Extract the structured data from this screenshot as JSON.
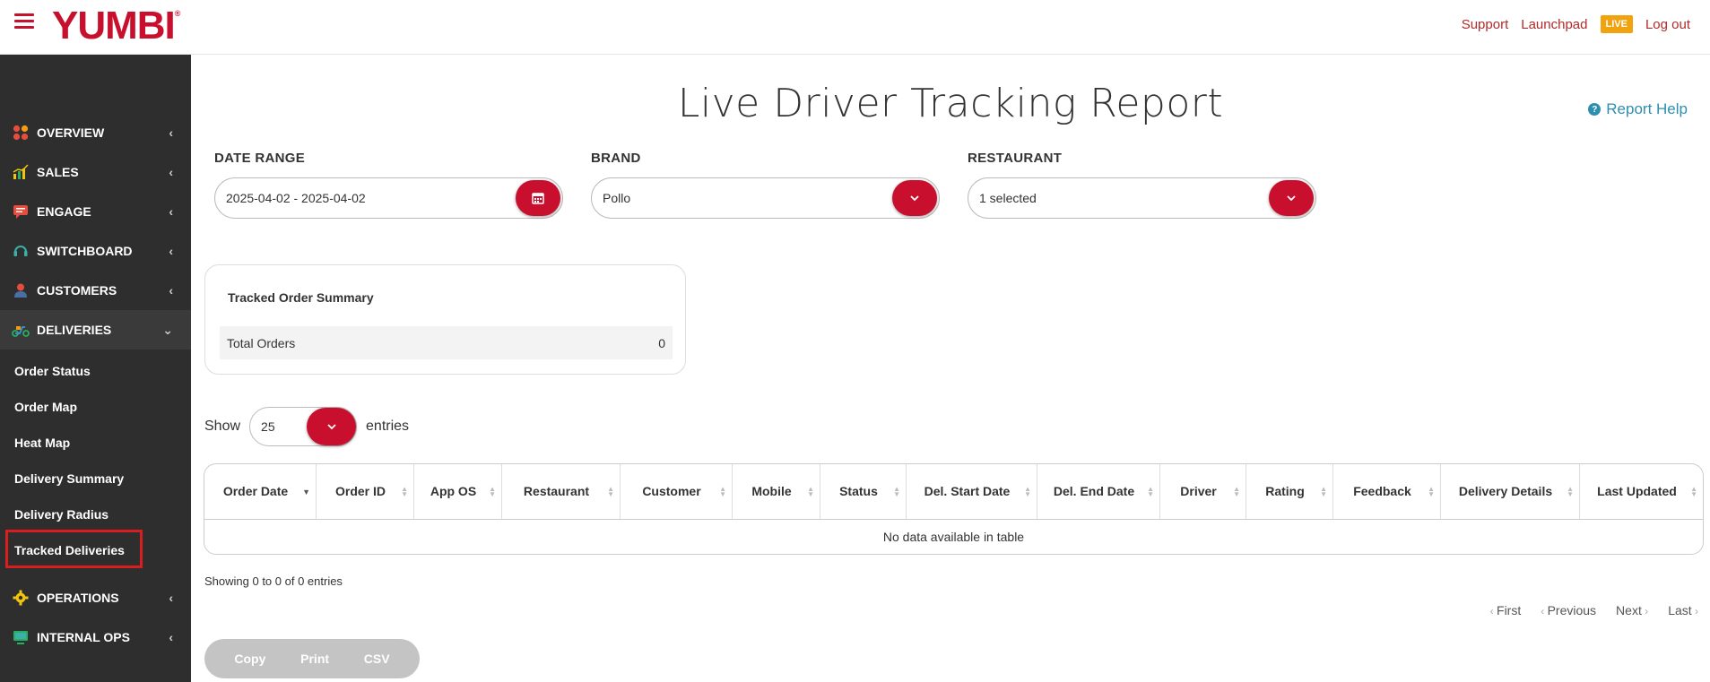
{
  "brand": {
    "logo": "YUMBI",
    "reg": "®",
    "color": "#c8102e"
  },
  "topnav": {
    "support": "Support",
    "launchpad": "Launchpad",
    "live": "LIVE",
    "logout": "Log out"
  },
  "sidebar": {
    "items": [
      {
        "label": "OVERVIEW",
        "icon": "dots-grid-icon"
      },
      {
        "label": "SALES",
        "icon": "bar-chart-icon"
      },
      {
        "label": "ENGAGE",
        "icon": "chat-icon"
      },
      {
        "label": "SWITCHBOARD",
        "icon": "headset-icon"
      },
      {
        "label": "CUSTOMERS",
        "icon": "user-icon"
      },
      {
        "label": "DELIVERIES",
        "icon": "scooter-icon"
      },
      {
        "label": "OPERATIONS",
        "icon": "gear-icon"
      },
      {
        "label": "INTERNAL OPS",
        "icon": "monitor-icon"
      }
    ],
    "sub_items": [
      "Order Status",
      "Order Map",
      "Heat Map",
      "Delivery Summary",
      "Delivery Radius",
      "Tracked Deliveries"
    ]
  },
  "page": {
    "title": "Live Driver Tracking Report",
    "help": "Report Help"
  },
  "filters": {
    "date_label": "DATE RANGE",
    "date_value": "2025-04-02 - 2025-04-02",
    "brand_label": "BRAND",
    "brand_value": "Pollo",
    "restaurant_label": "RESTAURANT",
    "restaurant_value": "1 selected"
  },
  "summary": {
    "title": "Tracked Order Summary",
    "total_label": "Total Orders",
    "total_value": "0"
  },
  "entries": {
    "show": "Show",
    "value": "25",
    "entries": "entries"
  },
  "table": {
    "columns": [
      "Order Date",
      "Order ID",
      "App OS",
      "Restaurant",
      "Customer",
      "Mobile",
      "Status",
      "Del. Start Date",
      "Del. End Date",
      "Driver",
      "Rating",
      "Feedback",
      "Delivery Details",
      "Last Updated"
    ],
    "empty": "No data available in table"
  },
  "info": "Showing 0 to 0 of 0 entries",
  "pager": {
    "first": "First",
    "previous": "Previous",
    "next": "Next",
    "last": "Last"
  },
  "export": {
    "copy": "Copy",
    "print": "Print",
    "csv": "CSV"
  }
}
